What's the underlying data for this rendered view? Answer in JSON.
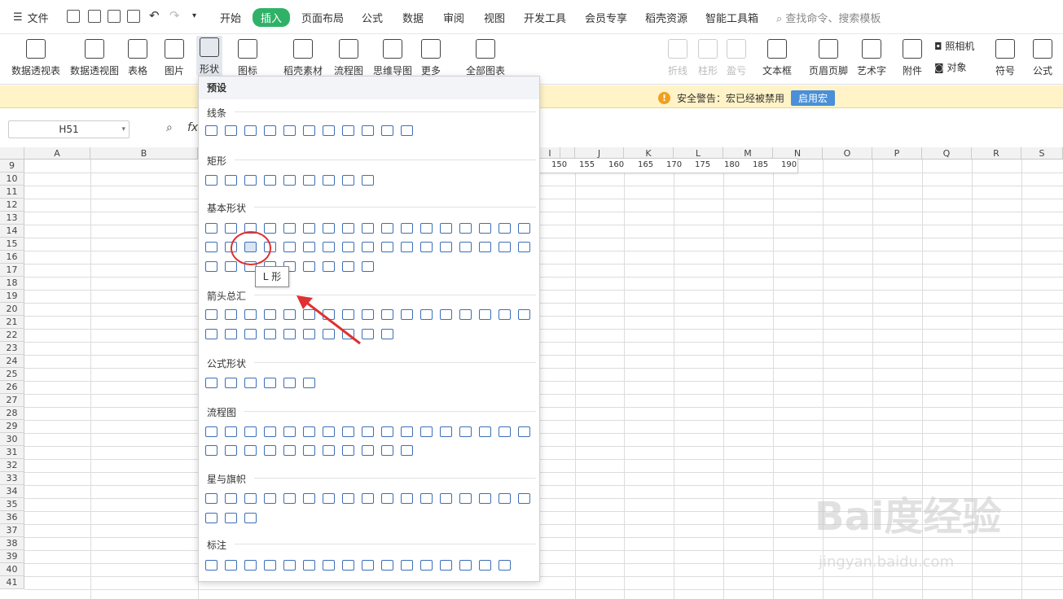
{
  "menu": {
    "file_label": "文件",
    "tabs": [
      "开始",
      "插入",
      "页面布局",
      "公式",
      "数据",
      "审阅",
      "视图",
      "开发工具",
      "会员专享",
      "稻壳资源",
      "智能工具箱"
    ],
    "search_placeholder": "查找命令、搜索模板"
  },
  "ribbon": {
    "buttons": [
      "数据透视表",
      "数据透视图",
      "表格",
      "图片",
      "形状",
      "图标",
      "稻壳素材",
      "流程图",
      "思维导图",
      "更多",
      "全部图表",
      "折线",
      "柱形",
      "盈亏",
      "文本框",
      "页眉页脚",
      "艺术字",
      "附件",
      "符号",
      "公式"
    ],
    "small": {
      "camera": "照相机",
      "object": "对象"
    }
  },
  "warning": {
    "text": "安全警告：宏已经被禁用",
    "button": "启用宏"
  },
  "formula": {
    "namebox": "H51",
    "fx": "fx"
  },
  "columns": [
    "A",
    "B",
    "I",
    "J",
    "K",
    "L",
    "M",
    "N",
    "O",
    "P",
    "Q",
    "R",
    "S"
  ],
  "rows": [
    "9",
    "10",
    "11",
    "12",
    "13",
    "14",
    "15",
    "16",
    "17",
    "18",
    "19",
    "20",
    "21",
    "22",
    "23",
    "24",
    "25",
    "26",
    "27",
    "28",
    "29",
    "30",
    "31",
    "32",
    "33",
    "34",
    "35",
    "36",
    "37",
    "38",
    "39",
    "40",
    "41"
  ],
  "row9_values": [
    "150",
    "155",
    "160",
    "165",
    "170",
    "175",
    "180",
    "185",
    "190"
  ],
  "dropdown": {
    "preset": "预设",
    "sections": [
      "线条",
      "矩形",
      "基本形状",
      "箭头总汇",
      "公式形状",
      "流程图",
      "星与旗帜",
      "标注"
    ]
  },
  "tooltip": "L 形",
  "watermark": {
    "brand": "Bai度经验",
    "url": "jingyan.baidu.com"
  }
}
